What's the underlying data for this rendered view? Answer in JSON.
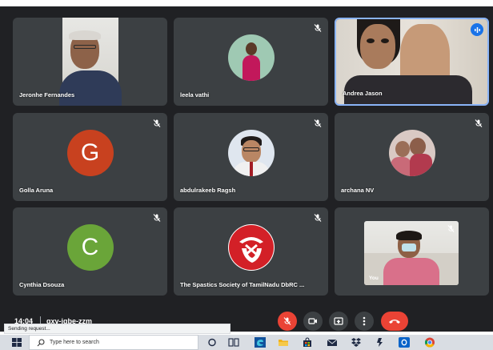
{
  "meeting": {
    "time": "14:04",
    "code": "qxv-igbe-zzm"
  },
  "participants": [
    {
      "name": "Jeronhe Fernandes",
      "type": "video",
      "muted": false
    },
    {
      "name": "leela vathi",
      "type": "photo-avatar",
      "muted": true
    },
    {
      "name": "Andrea Jason",
      "type": "video",
      "muted": false,
      "speaking": true
    },
    {
      "name": "Golla Aruna",
      "type": "letter-avatar",
      "letter": "G",
      "avatar_color": "#c8411f",
      "muted": true
    },
    {
      "name": "abdulrakeeb Ragsh",
      "type": "photo-avatar",
      "muted": true
    },
    {
      "name": "archana NV",
      "type": "photo-avatar",
      "muted": true
    },
    {
      "name": "Cynthia Dsouza",
      "type": "letter-avatar",
      "letter": "C",
      "avatar_color": "#6aa539",
      "muted": true
    },
    {
      "name": "The Spastics Society of TamilNadu DbRC ...",
      "type": "logo-avatar",
      "muted": true
    },
    {
      "name": "You",
      "type": "self-view",
      "muted": true
    }
  ],
  "controls": [
    "mic-off",
    "camera",
    "present",
    "more-options",
    "end-call"
  ],
  "browser_status": "Sending request...",
  "taskbar": {
    "search_placeholder": "Type here to search",
    "icons": [
      "windows-start",
      "cortana",
      "task-view",
      "edge",
      "file-explorer",
      "store",
      "mail",
      "dropbox",
      "app",
      "outlook",
      "chrome"
    ]
  },
  "colors": {
    "accent": "#1a73e8",
    "danger": "#ea4335",
    "tile": "#3c4043",
    "background": "#202124"
  }
}
